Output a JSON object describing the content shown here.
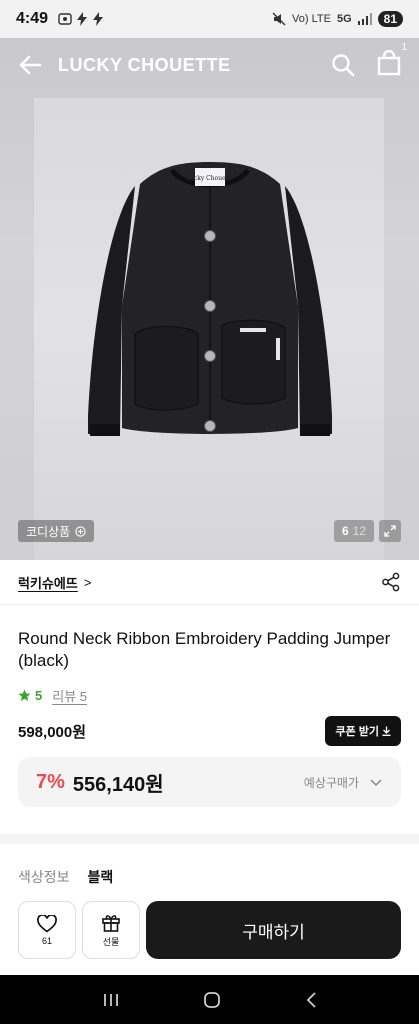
{
  "status_bar": {
    "time": "4:49",
    "signal_text": "Vo) LTE",
    "network": "5G",
    "battery": "81"
  },
  "header": {
    "brand_title": "LUCKY CHOUETTE",
    "cart_count": "1"
  },
  "hero": {
    "coordi_label": "코디상품",
    "image_index": "6",
    "image_total": "12",
    "jacket_tag": "Lucky Chouette"
  },
  "brand": {
    "name": "럭키슈에뜨",
    "chevron": ">"
  },
  "product": {
    "name": "Round Neck Ribbon Embroidery Padding Jumper (black)",
    "rating": "5",
    "review_label": "리뷰 5",
    "original_price": "598,000원",
    "coupon_label": "쿠폰 받기",
    "discount_rate": "7%",
    "sale_price": "556,140원",
    "expected_label": "예상구매가"
  },
  "color": {
    "label": "색상정보",
    "value": "블랙"
  },
  "bottom": {
    "like_count": "61",
    "gift_label": "선물",
    "buy_label": "구매하기"
  },
  "colors": {
    "accent_green": "#3aa62e",
    "discount_red": "#f0484d",
    "dark": "#111111"
  }
}
